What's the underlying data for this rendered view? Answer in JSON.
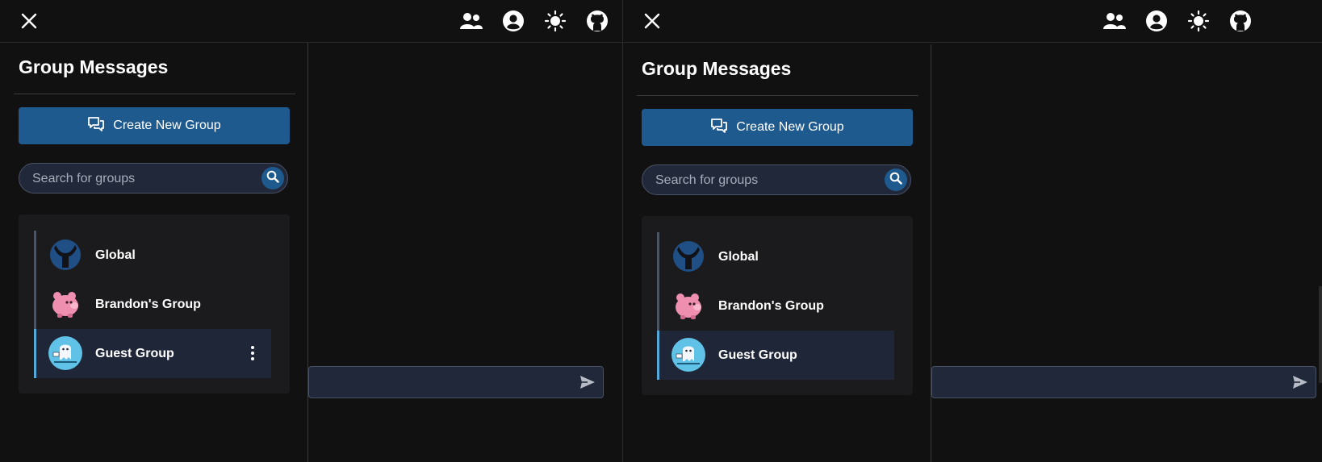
{
  "panes": [
    {
      "sidebar": {
        "title": "Group Messages",
        "create_button_label": "Create New Group",
        "search_placeholder": "Search for groups",
        "groups": [
          {
            "name": "Global",
            "avatar": "globe-y-icon"
          },
          {
            "name": "Brandon's Group",
            "avatar": "pink-pig-avatar"
          },
          {
            "name": "Guest Group",
            "avatar": "ghost-seal-avatar",
            "selected": true,
            "show_menu": true
          }
        ]
      }
    },
    {
      "sidebar": {
        "title": "Group Messages",
        "create_button_label": "Create New Group",
        "search_placeholder": "Search for groups",
        "groups": [
          {
            "name": "Global",
            "avatar": "globe-y-icon"
          },
          {
            "name": "Brandon's Group",
            "avatar": "pink-pig-avatar"
          },
          {
            "name": "Guest Group",
            "avatar": "ghost-seal-avatar",
            "selected": true,
            "show_menu": false
          }
        ]
      }
    }
  ],
  "topbar_icons": [
    "close-icon",
    "users-icon",
    "account-icon",
    "theme-sun-icon",
    "github-icon"
  ],
  "colors": {
    "background": "#111112",
    "primary": "#1f5a8f",
    "selected_row": "#1f2638",
    "selected_accent": "#55a8d8",
    "input_bg": "#20283a"
  }
}
